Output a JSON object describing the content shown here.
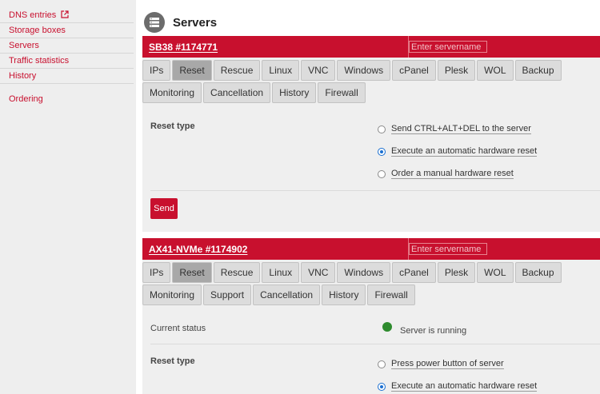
{
  "sidebar": {
    "items": [
      {
        "label": "DNS entries"
      },
      {
        "label": "Storage boxes"
      },
      {
        "label": "Servers"
      },
      {
        "label": "Traffic statistics"
      },
      {
        "label": "History"
      },
      {
        "label": "Ordering"
      }
    ]
  },
  "page": {
    "title": "Servers",
    "icon": "server-icon"
  },
  "colors": {
    "accent": "#c8102e",
    "status_running": "#2e8b2e"
  },
  "servers": [
    {
      "name": "SB38 #1174771",
      "servername_placeholder": "Enter servername",
      "tabs": [
        "IPs",
        "Reset",
        "Rescue",
        "Linux",
        "VNC",
        "Windows",
        "cPanel",
        "Plesk",
        "WOL",
        "Backup",
        "Monitoring",
        "Cancellation",
        "History",
        "Firewall"
      ],
      "active_tab": "Reset",
      "reset_type_label": "Reset type",
      "options": [
        {
          "label": "Send CTRL+ALT+DEL to the server",
          "checked": false
        },
        {
          "label": "Execute an automatic hardware reset",
          "checked": true
        },
        {
          "label": "Order a manual hardware reset",
          "checked": false
        }
      ],
      "send_label": "Send"
    },
    {
      "name": "AX41-NVMe #1174902",
      "servername_placeholder": "Enter servername",
      "tabs": [
        "IPs",
        "Reset",
        "Rescue",
        "Linux",
        "VNC",
        "Windows",
        "cPanel",
        "Plesk",
        "WOL",
        "Backup",
        "Monitoring",
        "Support",
        "Cancellation",
        "History",
        "Firewall"
      ],
      "active_tab": "Reset",
      "status_label": "Current status",
      "status_text": "Server is running",
      "reset_type_label": "Reset type",
      "options": [
        {
          "label": "Press power button of server",
          "checked": false
        },
        {
          "label": "Execute an automatic hardware reset",
          "checked": true
        }
      ]
    }
  ]
}
